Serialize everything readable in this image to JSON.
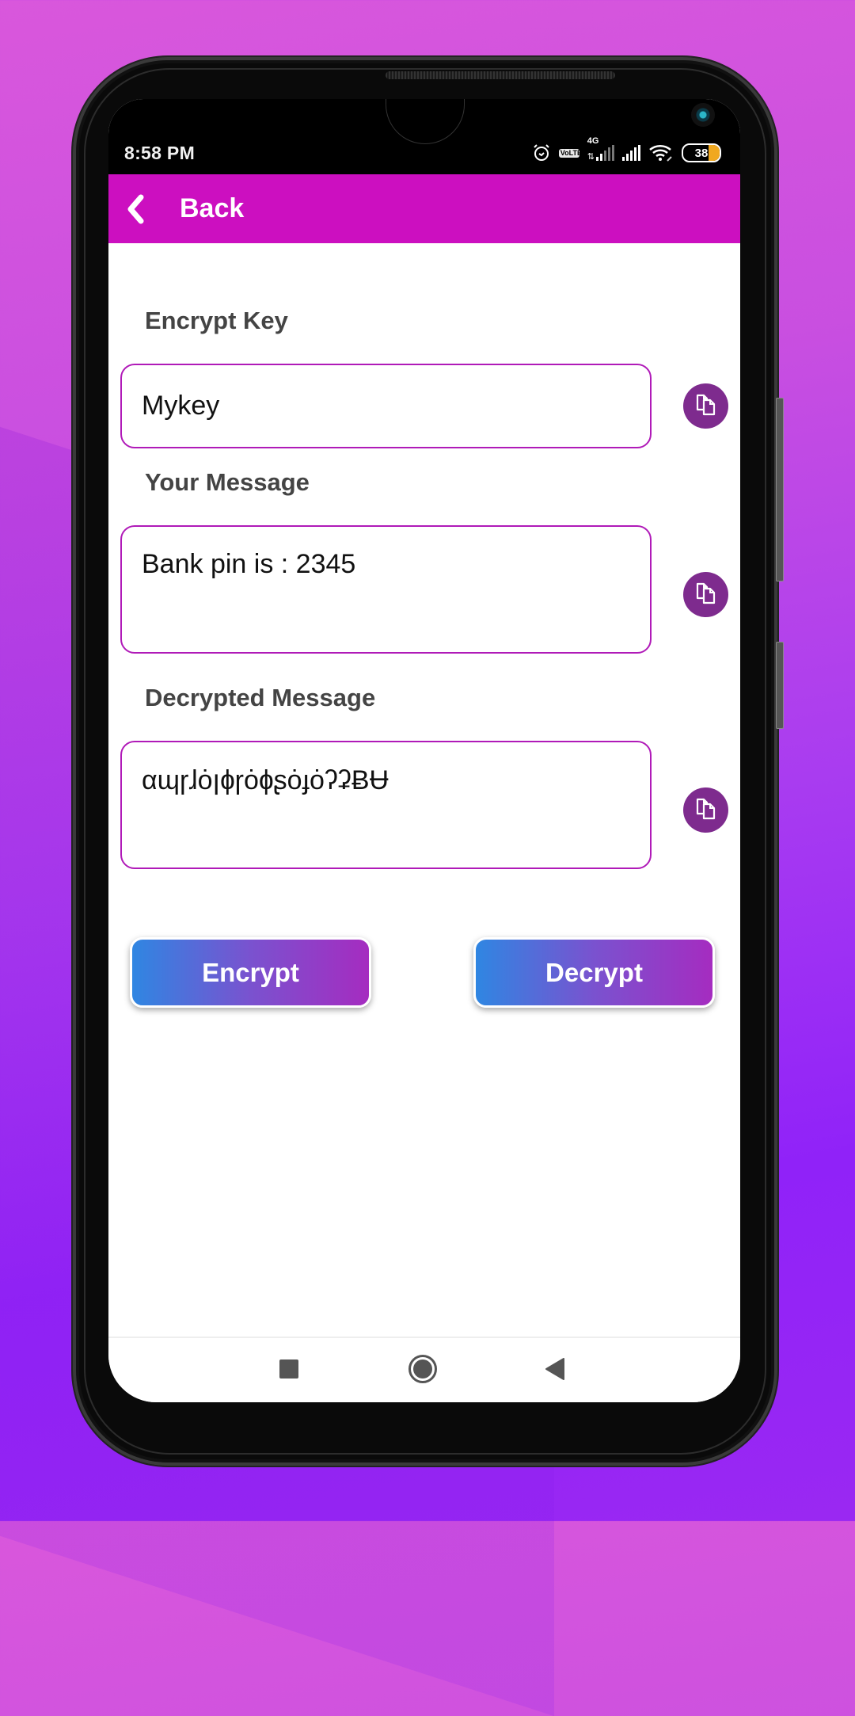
{
  "status_bar": {
    "time": "8:58 PM",
    "icons": [
      "alarm-icon",
      "volte-icon",
      "4g-signal-icon",
      "signal-icon",
      "wifi-icon",
      "battery-icon"
    ],
    "volte_top": "Vo",
    "volte_bottom": "LTE",
    "network_type": "4G",
    "battery_level": "38"
  },
  "app_bar": {
    "back_label": "Back",
    "color": "#CC0FC0"
  },
  "form": {
    "encrypt_key": {
      "label": "Encrypt Key",
      "value": "Mykey"
    },
    "your_message": {
      "label": "Your Message",
      "value": "Bank pin is : 2345"
    },
    "decrypted_message": {
      "label": "Decrypted Message",
      "value": "αɰɼɺȯꞁɸɼȯɸʂȯɟȯʔʡɃɄ"
    },
    "copy_button_color": "#7E2B8E",
    "field_border_color": "#B01AB8"
  },
  "actions": {
    "encrypt_label": "Encrypt",
    "decrypt_label": "Decrypt"
  },
  "nav_bar": {
    "items": [
      "recents-icon",
      "home-icon",
      "back-icon"
    ]
  }
}
